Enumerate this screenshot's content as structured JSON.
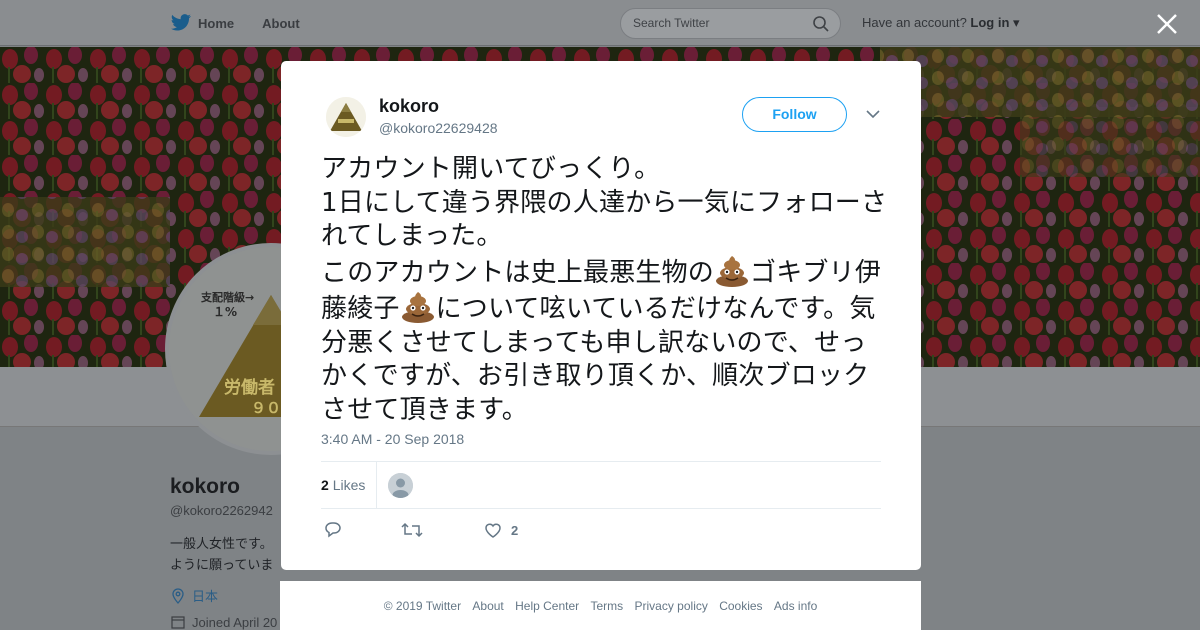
{
  "nav": {
    "home_label": "Home",
    "about_label": "About",
    "search_placeholder": "Search Twitter",
    "have_account": "Have an account?",
    "login_label": "Log in"
  },
  "profile_bg": {
    "avatar_text_top": "支配階級→",
    "avatar_text_pct": "１%",
    "avatar_text_bottom": "労働者",
    "avatar_text_num": "９０",
    "name": "kokoro",
    "handle": "@kokoro2262942",
    "bio_line1": "一般人女性です。",
    "bio_line2": "ように願っていま",
    "location": "日本",
    "joined": "Joined April 20"
  },
  "tweet": {
    "author_name": "kokoro",
    "author_handle": "@kokoro22629428",
    "follow_label": "Follow",
    "text_part1": "アカウント開いてびっくり。\n1日にして違う界隈の人達から一気にフォローされてしまった。\nこのアカウントは史上最悪生物の",
    "text_part2": "ゴキブリ伊藤綾子",
    "text_part3": "について呟いているだけなんです。気分悪くさせてしまっても申し訳ないので、せっかくですが、お引き取り頂くか、順次ブロックさせて頂きます。",
    "timestamp": "3:40 AM - 20 Sep 2018",
    "likes_count": "2",
    "likes_label": "Likes",
    "like_action_count": "2"
  },
  "footer": {
    "links": [
      "© 2019 Twitter",
      "About",
      "Help Center",
      "Terms",
      "Privacy policy",
      "Cookies",
      "Ads info"
    ]
  },
  "colors": {
    "twitter_blue": "#1da1f2",
    "secondary_text": "#657786",
    "overlay": "#7f8386"
  },
  "icons": {
    "logo": "twitter-bird-icon",
    "search": "search-icon",
    "close": "close-icon",
    "emoji": "pile-of-poo-emoji",
    "reply": "reply-icon",
    "retweet": "retweet-icon",
    "like": "heart-icon"
  }
}
